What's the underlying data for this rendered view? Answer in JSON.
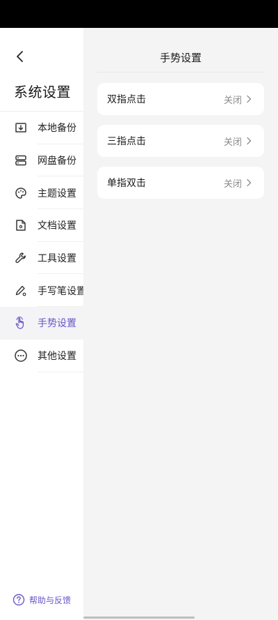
{
  "colors": {
    "accent": "#6a55c8",
    "status_bar": "#000000",
    "main_bg": "#f4f4f5",
    "active_nav_bg": "#f4f4f6"
  },
  "sidebar": {
    "title": "系统设置",
    "back_icon": "chevron-left-icon",
    "items": [
      {
        "label": "本地备份",
        "icon": "local-backup-icon",
        "active": false
      },
      {
        "label": "网盘备份",
        "icon": "cloud-storage-icon",
        "active": false
      },
      {
        "label": "主题设置",
        "icon": "palette-icon",
        "active": false
      },
      {
        "label": "文档设置",
        "icon": "document-settings-icon",
        "active": false
      },
      {
        "label": "工具设置",
        "icon": "wrench-icon",
        "active": false
      },
      {
        "label": "手写笔设置",
        "icon": "pen-settings-icon",
        "active": false
      },
      {
        "label": "手势设置",
        "icon": "hand-gesture-icon",
        "active": true
      },
      {
        "label": "其他设置",
        "icon": "more-dots-icon",
        "active": false
      }
    ],
    "help_label": "帮助与反馈"
  },
  "main": {
    "title": "手势设置",
    "rows": [
      {
        "label": "双指点击",
        "value": "关闭"
      },
      {
        "label": "三指点击",
        "value": "关闭"
      },
      {
        "label": "单指双击",
        "value": "关闭"
      }
    ]
  }
}
